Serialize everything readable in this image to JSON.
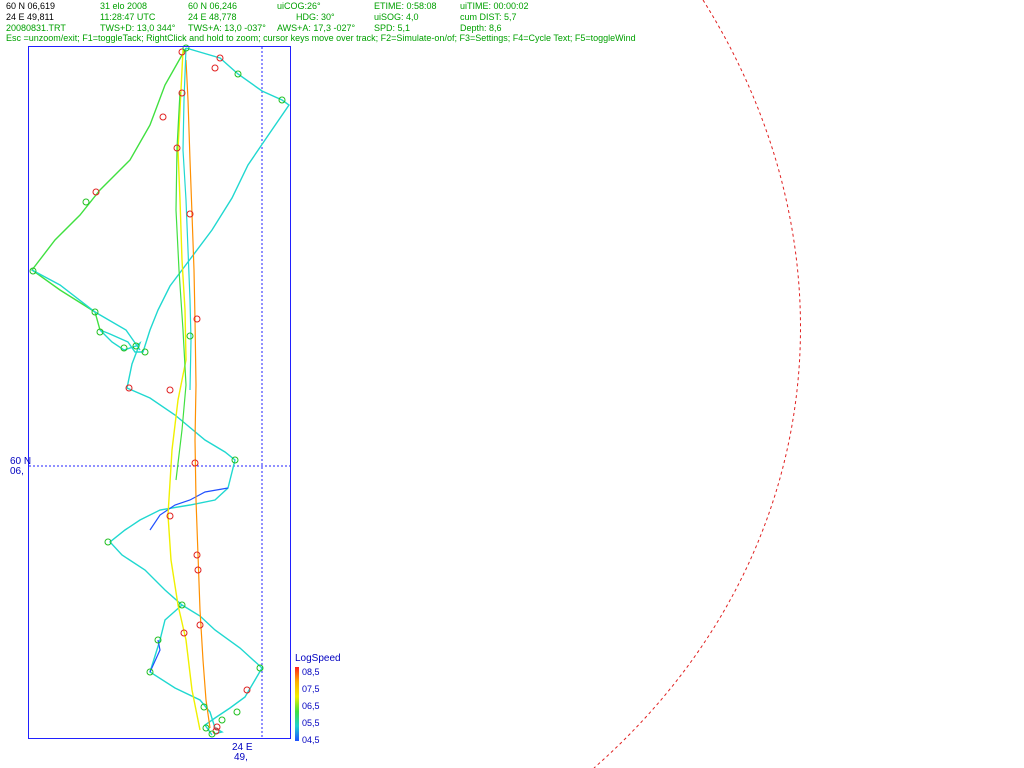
{
  "header": {
    "col1": {
      "row1": "60 N 06,619",
      "row2": "24 E 49,811",
      "row3": "20080831.TRT"
    },
    "col2": {
      "row1": "31 elo 2008",
      "row2": "11:28:47  UTC",
      "row3": "TWS+D: 13,0 344°"
    },
    "col3": {
      "row1": "60 N 06,246",
      "row2": "24 E 48,778",
      "row3": "TWS+A: 13,0 -037°"
    },
    "col4": {
      "row1": "uiCOG:26°",
      "row2": "HDG: 30°",
      "row3": "AWS+A: 17,3 -027°"
    },
    "col5": {
      "row1": "ETIME: 0:58:08",
      "row2": "uiSOG: 4,0",
      "row3": "SPD: 5,1"
    },
    "col6": {
      "row1": "uiTIME: 00:00:02",
      "row2": "cum DIST: 5,7",
      "row3": "Depth: 8,6"
    },
    "help": "Esc =unzoom/exit; F1=toggleTack; RightClick and hold to zoom; cursor keys move over track; F2=Simulate-on/of; F3=Settings; F4=Cycle Text; F5=toggleWind"
  },
  "axis": {
    "lat_deg": "60 N",
    "lat_min": "06,",
    "lon_deg": "24 E",
    "lon_min": "49,"
  },
  "legend": {
    "title": "LogSpeed",
    "labels": [
      "08,5",
      "07,5",
      "06,5",
      "05,5",
      "04,5"
    ],
    "colors": [
      "#ff2020",
      "#ffb000",
      "#40e040",
      "#20d0d0",
      "#2050ff"
    ]
  },
  "colors": {
    "frame": "#2020ff",
    "track_cyan": "#20d8d0",
    "track_green": "#40e040",
    "track_yellow": "#f0f000",
    "track_orange": "#ff9000",
    "track_blue": "#2050ff",
    "marker_red": "#e02020",
    "marker_green": "#20c020",
    "wind_arc": "#e02020",
    "crosshair": "#2020ff"
  }
}
